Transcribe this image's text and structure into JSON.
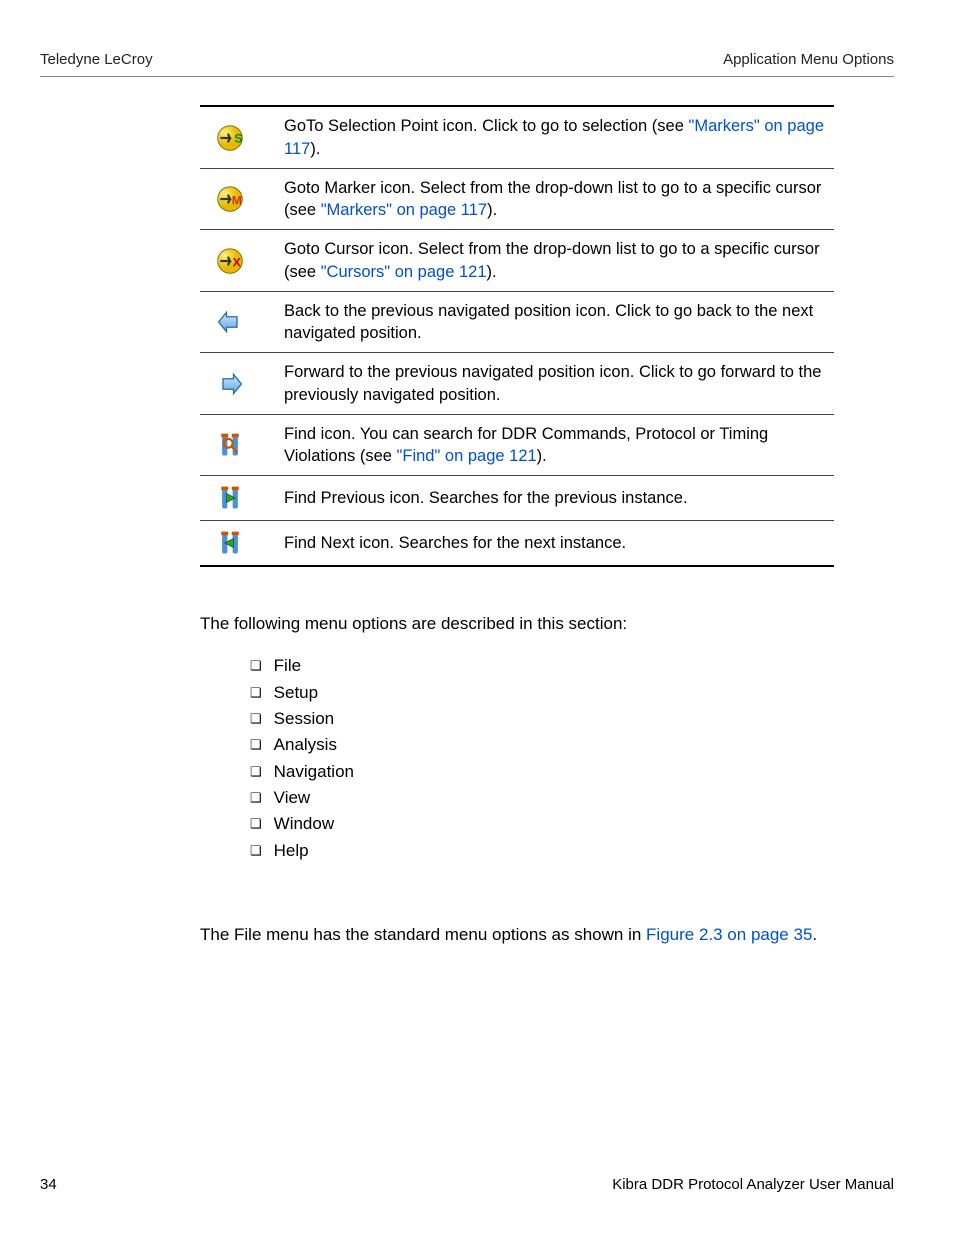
{
  "header": {
    "left": "Teledyne LeCroy",
    "right": "Application Menu Options"
  },
  "rows": [
    {
      "icon": "goto-selection",
      "pre": "GoTo Selection Point icon. Click to go to selection (see ",
      "link": "\"Markers\" on page 117",
      "post": ")."
    },
    {
      "icon": "goto-marker",
      "pre": "Goto Marker icon. Select from the drop-down list to go to a specific cursor (see ",
      "link": "\"Markers\" on page 117",
      "post": ")."
    },
    {
      "icon": "goto-cursor",
      "pre": "Goto Cursor icon. Select from the drop-down list to go to a specific cursor (see ",
      "link": "\"Cursors\" on page 121",
      "post": ")."
    },
    {
      "icon": "nav-back",
      "pre": "Back to the previous navigated position icon. Click to go back to the next navigated position.",
      "link": "",
      "post": ""
    },
    {
      "icon": "nav-forward",
      "pre": "Forward to the previous navigated position icon. Click to go forward to the previously navigated position.",
      "link": "",
      "post": ""
    },
    {
      "icon": "find",
      "pre": "Find icon. You can search for DDR Commands, Protocol or Timing Violations (see ",
      "link": "\"Find\" on page 121",
      "post": ")."
    },
    {
      "icon": "find-prev",
      "pre": "Find Previous icon. Searches for the previous instance.",
      "link": "",
      "post": ""
    },
    {
      "icon": "find-next",
      "pre": "Find Next icon. Searches for the next instance.",
      "link": "",
      "post": ""
    }
  ],
  "intro": "The following menu options are described in this section:",
  "menu_items": [
    "File",
    "Setup",
    "Session",
    "Analysis",
    "Navigation",
    "View",
    "Window",
    "Help"
  ],
  "file_para_pre": "The File menu has the standard menu options as shown in ",
  "file_para_link": "Figure 2.3 on page 35",
  "file_para_post": ".",
  "footer": {
    "left": "34",
    "right": "Kibra DDR Protocol Analyzer User Manual"
  }
}
